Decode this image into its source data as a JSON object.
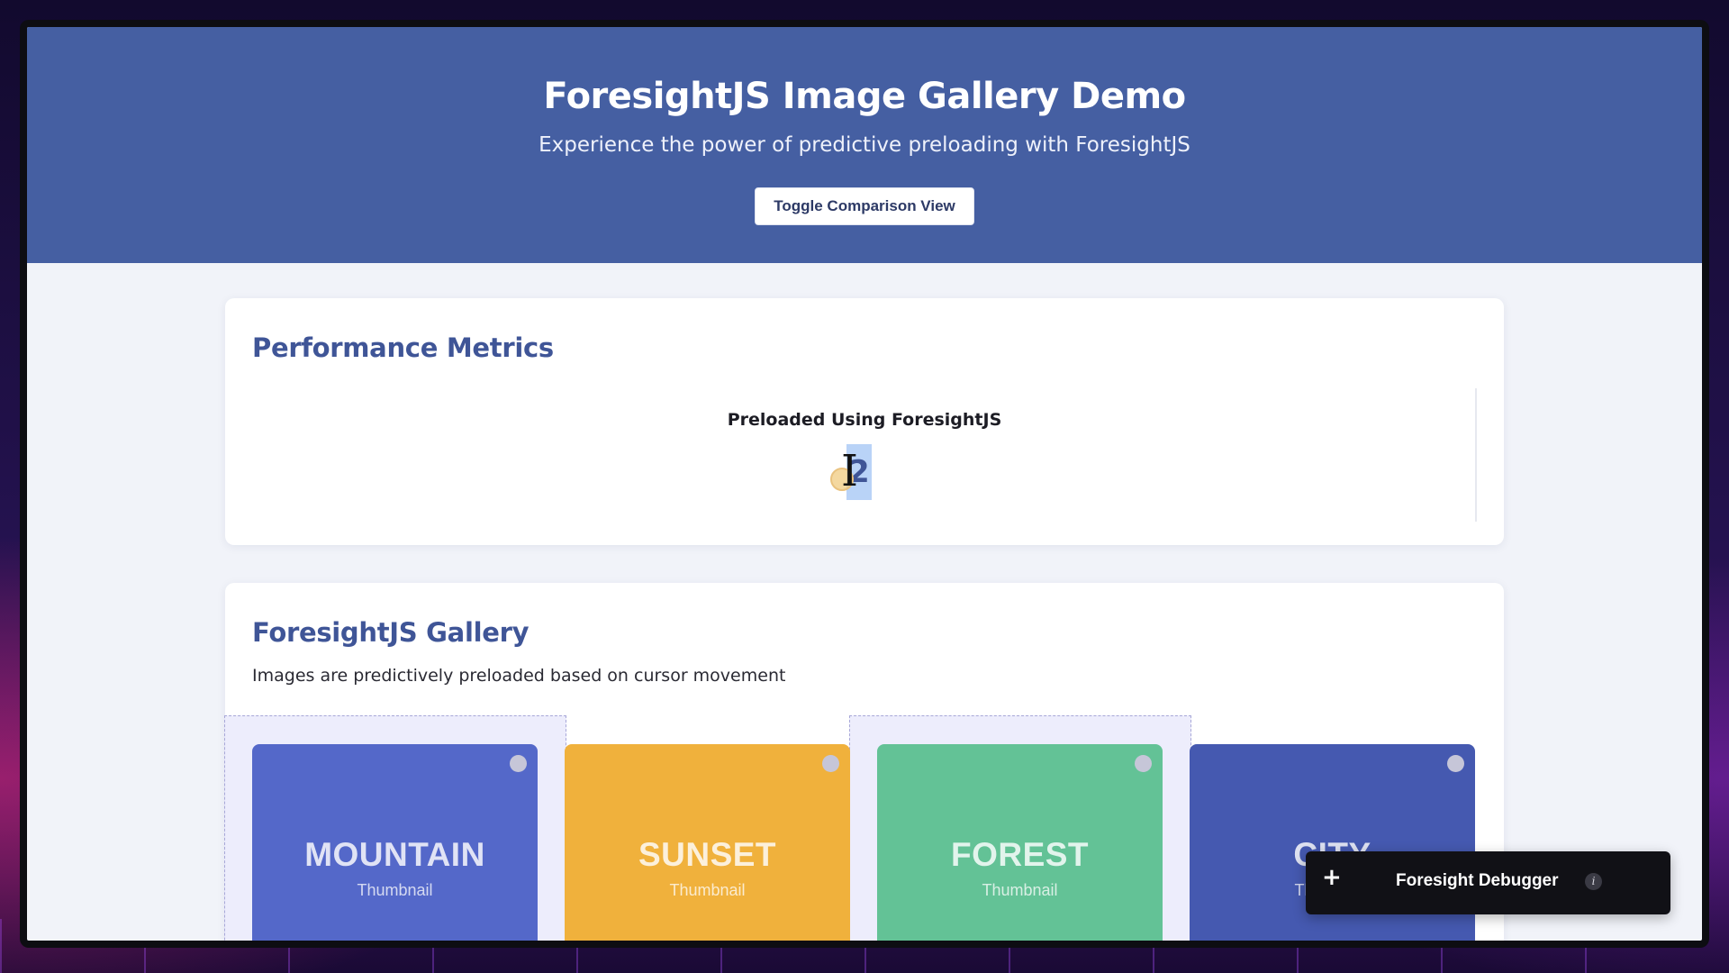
{
  "header": {
    "title": "ForesightJS Image Gallery Demo",
    "subtitle": "Experience the power of predictive preloading with ForesightJS",
    "toggle_label": "Toggle Comparison View"
  },
  "metrics": {
    "heading": "Performance Metrics",
    "label": "Preloaded Using ForesightJS",
    "value": "2"
  },
  "gallery": {
    "heading": "ForesightJS Gallery",
    "description": "Images are predictively preloaded based on cursor movement",
    "items": [
      {
        "name": "MOUNTAIN",
        "sub": "Thumbnail",
        "color": "#5468c9"
      },
      {
        "name": "SUNSET",
        "sub": "Thumbnail",
        "color": "#f0b13c"
      },
      {
        "name": "FOREST",
        "sub": "Thumbnail",
        "color": "#63c296"
      },
      {
        "name": "CITY",
        "sub": "Thumbnail",
        "color": "#4559b0"
      }
    ]
  },
  "debugger": {
    "plus": "+",
    "title": "Foresight Debugger",
    "info": "i"
  },
  "colors": {
    "header_bg": "#455fa2",
    "heading": "#3f5597"
  }
}
